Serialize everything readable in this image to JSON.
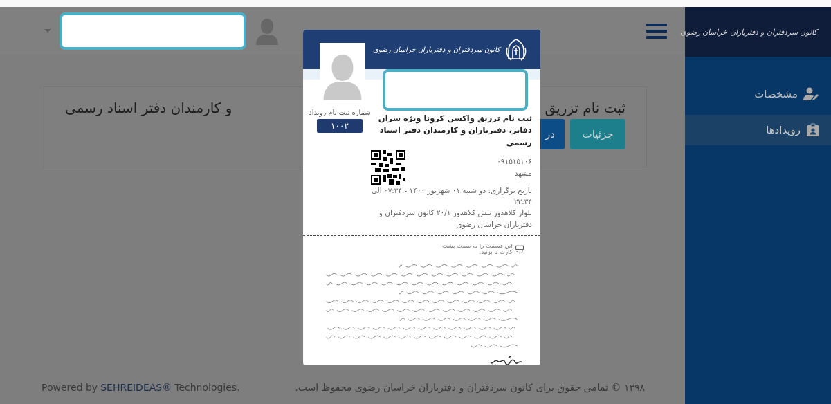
{
  "sidebar": {
    "logo_text": "کانون سردفتران و دفتریاران خراسان رضوی",
    "items": [
      {
        "label": "مشخصات",
        "selected": false
      },
      {
        "label": "رویدادها",
        "selected": true
      }
    ]
  },
  "event": {
    "title_parts": [
      "ثبت نام تزریق",
      "و کارمندان دفتر اسناد رسمی"
    ],
    "buttons": [
      {
        "label": "جزئیات",
        "kind": "details"
      },
      {
        "label": "در",
        "kind": "primary"
      }
    ]
  },
  "footer": {
    "powered_prefix": "Powered by",
    "brand": "SEHREIDEAS®",
    "powered_suffix": "Technologies.",
    "copyright": "۱۳۹۸ © تمامی حقوق برای کانون سردفتران و دفتریاران خراسان رضوی محفوظ است."
  },
  "ticket": {
    "logo_text": "کانون سردفتران و دفتریاران خراسان رضوی",
    "title": "ثبت نام تزریق واکسن کرونا ویژه سران دفاتر، دفتریاران و کارمندان دفتر اسناد رسمی",
    "registration_label": "شماره ثبت نام رویداد",
    "registration_number": "۱۰۰۲",
    "phone": "۰۹۱۵۱۵۱۰۶",
    "city": "مشهد",
    "date": "تاریخ برگزاری: دو شنبه ۰۱ شهریور ۱۴۰۰ - ۰۷:۳۴ الی ۲۳:۳۴",
    "address": "بلوار کلاهدوز نبش کلاهدوز ۲۰/۱ کانون سردفتران و دفتریاران خراسان رضوی",
    "fold_hint": "این قسمت را به سمت پشت کارت تا بزنید."
  }
}
